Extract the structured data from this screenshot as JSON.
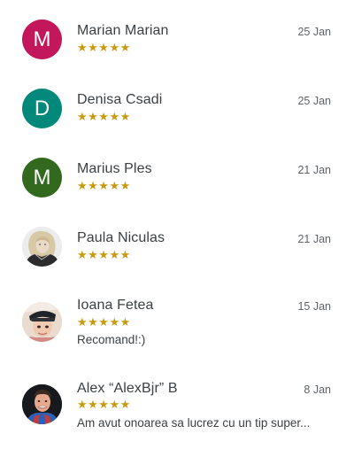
{
  "reviews": [
    {
      "name": "Marian Marian",
      "date": "25 Jan",
      "stars": "★★★★★",
      "text": "",
      "avatar": {
        "type": "letter",
        "letter": "M",
        "color": "#c2185b"
      }
    },
    {
      "name": "Denisa Csadi",
      "date": "25 Jan",
      "stars": "★★★★★",
      "text": "",
      "avatar": {
        "type": "letter",
        "letter": "D",
        "color": "#00897b"
      }
    },
    {
      "name": "Marius Ples",
      "date": "21 Jan",
      "stars": "★★★★★",
      "text": "",
      "avatar": {
        "type": "letter",
        "letter": "M",
        "color": "#33691e"
      }
    },
    {
      "name": "Paula Niculas",
      "date": "21 Jan",
      "stars": "★★★★★",
      "text": "",
      "avatar": {
        "type": "photo",
        "icon": "user-photo-icon"
      }
    },
    {
      "name": "Ioana Fetea",
      "date": "15 Jan",
      "stars": "★★★★★",
      "text": "Recomand!:)",
      "avatar": {
        "type": "photo",
        "icon": "user-photo-icon"
      }
    },
    {
      "name": "Alex “AlexBjr” B",
      "date": "8 Jan",
      "stars": "★★★★★",
      "text": "Am avut onoarea sa lucrez cu un tip super...",
      "avatar": {
        "type": "photo",
        "icon": "user-photo-icon"
      }
    }
  ],
  "colors": {
    "star": "#c99a0e",
    "name": "#3c4043",
    "date": "#5f6368"
  }
}
